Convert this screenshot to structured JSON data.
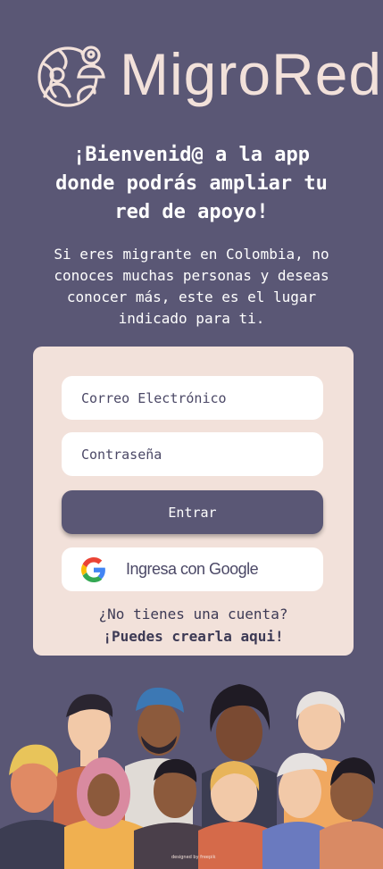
{
  "brand": {
    "name": "MigroRed",
    "logo_icon": "globe-people-icon"
  },
  "welcome": {
    "line1": "¡Bienvenid@ a la app",
    "line2": "donde podrás ampliar tu",
    "line3": "red de apoyo!"
  },
  "intro": {
    "line1": "Si eres migrante en Colombia, no",
    "line2": "conoces muchas personas y deseas",
    "line3": "conocer más, este es el lugar",
    "line4": "indicado para ti."
  },
  "form": {
    "email_placeholder": "Correo Electrónico",
    "password_placeholder": "Contraseña",
    "submit_label": "Entrar",
    "google_label": "Ingresa con Google",
    "google_icon": "google-g-icon",
    "signup_question": "¿No tienes una cuenta?",
    "signup_link": "¡Puedes crearla aqui!"
  },
  "illustration": {
    "credit": "designed by freepik"
  },
  "colors": {
    "background": "#5a5775",
    "card": "#f2e1da",
    "button": "#5a5775",
    "text_dark": "#3d3a55",
    "brand": "#f2e1da"
  }
}
